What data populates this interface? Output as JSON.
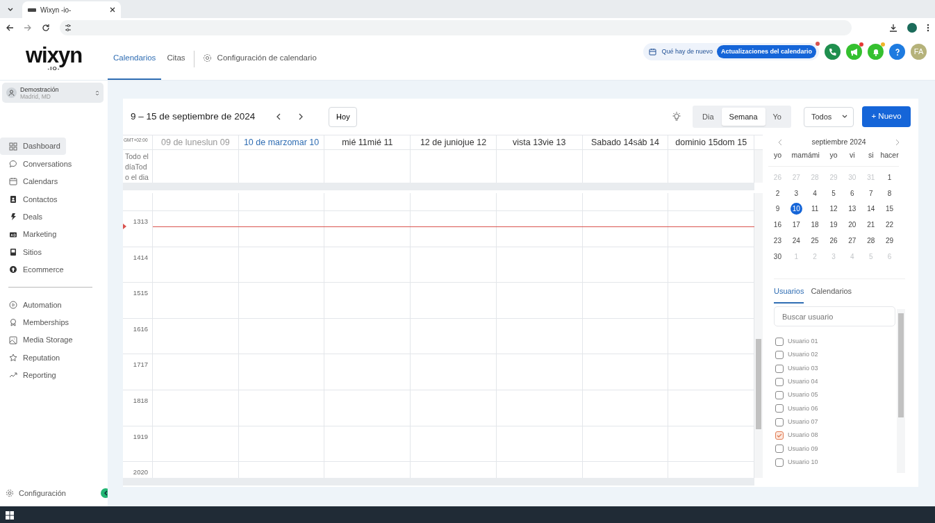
{
  "browser": {
    "tab_title": "Wixyn -io-"
  },
  "logo": {
    "name": "wixyn",
    "tagline": "-IO-"
  },
  "header_tabs": [
    {
      "label": "Calendarios",
      "selected": true,
      "kind": "text"
    },
    {
      "label": "Citas",
      "selected": false,
      "kind": "text"
    },
    {
      "label": "Configuración de calendario",
      "selected": false,
      "kind": "settings"
    }
  ],
  "whats_new": {
    "label": "Qué hay de nuevo",
    "badge": "Actualizaciones del calendario",
    "unread": true
  },
  "header_buttons": [
    {
      "kind": "phone",
      "unread": false
    },
    {
      "kind": "megaphone",
      "unread": true
    },
    {
      "kind": "bell",
      "unread": true
    },
    {
      "kind": "help",
      "unread": false
    },
    {
      "kind": "avatar",
      "label": "FA",
      "unread": false
    }
  ],
  "account": {
    "name": "Demostración",
    "location": "Madrid, MD"
  },
  "sidebar": {
    "groups": [
      {
        "items": [
          {
            "label": "Dashboard",
            "selected": true
          },
          {
            "label": "Conversations",
            "selected": false
          },
          {
            "label": "Calendars",
            "selected": false
          },
          {
            "label": "Contactos",
            "selected": false
          },
          {
            "label": "Deals",
            "selected": false
          },
          {
            "label": "Marketing",
            "selected": false
          },
          {
            "label": "Sitios",
            "selected": false
          },
          {
            "label": "Ecommerce",
            "selected": false
          }
        ]
      },
      {
        "items": [
          {
            "label": "Automation",
            "selected": false
          },
          {
            "label": "Memberships",
            "selected": false
          },
          {
            "label": "Media Storage",
            "selected": false
          },
          {
            "label": "Reputation",
            "selected": false
          },
          {
            "label": "Reporting",
            "selected": false
          }
        ]
      }
    ],
    "footer": "Configuración"
  },
  "toolbar": {
    "range": "9 – 15 de septiembre de 2024",
    "today": "Hoy",
    "views": [
      {
        "label": "Dia",
        "selected": false
      },
      {
        "label": "Semana",
        "selected": true
      },
      {
        "label": "Yo",
        "selected": false
      }
    ],
    "filter": "Todos",
    "new": "+ Nuevo"
  },
  "grid": {
    "timezone": "GMT+02:00",
    "all_day": "Todo el díaTodo el dia",
    "days": [
      {
        "label": "09 de luneslun 09",
        "kind": "past"
      },
      {
        "label": "10 de marzomar 10",
        "kind": "today"
      },
      {
        "label": "mié 11mié 11",
        "kind": "future"
      },
      {
        "label": "12 de juniojue 12",
        "kind": "future"
      },
      {
        "label": "vista 13vie 13",
        "kind": "future"
      },
      {
        "label": "Sabado 14sáb 14",
        "kind": "future"
      },
      {
        "label": "dominio 15dom 15",
        "kind": "future"
      }
    ],
    "hours": [
      "1313",
      "1414",
      "1515",
      "1616",
      "1717",
      "1818",
      "1919",
      "2020"
    ]
  },
  "mini_calendar": {
    "month": "septiembre 2024",
    "weekdays": [
      "yo",
      "mamámi",
      "yo",
      "vi",
      "si",
      "hacer"
    ],
    "weeks": [
      [
        {
          "label": "26",
          "muted": true,
          "selected": false
        },
        {
          "label": "27",
          "muted": true,
          "selected": false
        },
        {
          "label": "28",
          "muted": true,
          "selected": false
        },
        {
          "label": "29",
          "muted": true,
          "selected": false
        },
        {
          "label": "30",
          "muted": true,
          "selected": false
        },
        {
          "label": "31",
          "muted": true,
          "selected": false
        },
        {
          "label": "1",
          "muted": false,
          "selected": false
        }
      ],
      [
        {
          "label": "2",
          "muted": false,
          "selected": false
        },
        {
          "label": "3",
          "muted": false,
          "selected": false
        },
        {
          "label": "4",
          "muted": false,
          "selected": false
        },
        {
          "label": "5",
          "muted": false,
          "selected": false
        },
        {
          "label": "6",
          "muted": false,
          "selected": false
        },
        {
          "label": "7",
          "muted": false,
          "selected": false
        },
        {
          "label": "8",
          "muted": false,
          "selected": false
        }
      ],
      [
        {
          "label": "9",
          "muted": false,
          "selected": false
        },
        {
          "label": "10",
          "muted": false,
          "selected": true
        },
        {
          "label": "11",
          "muted": false,
          "selected": false
        },
        {
          "label": "12",
          "muted": false,
          "selected": false
        },
        {
          "label": "13",
          "muted": false,
          "selected": false
        },
        {
          "label": "14",
          "muted": false,
          "selected": false
        },
        {
          "label": "15",
          "muted": false,
          "selected": false
        }
      ],
      [
        {
          "label": "16",
          "muted": false,
          "selected": false
        },
        {
          "label": "17",
          "muted": false,
          "selected": false
        },
        {
          "label": "18",
          "muted": false,
          "selected": false
        },
        {
          "label": "19",
          "muted": false,
          "selected": false
        },
        {
          "label": "20",
          "muted": false,
          "selected": false
        },
        {
          "label": "21",
          "muted": false,
          "selected": false
        },
        {
          "label": "22",
          "muted": false,
          "selected": false
        }
      ],
      [
        {
          "label": "23",
          "muted": false,
          "selected": false
        },
        {
          "label": "24",
          "muted": false,
          "selected": false
        },
        {
          "label": "25",
          "muted": false,
          "selected": false
        },
        {
          "label": "26",
          "muted": false,
          "selected": false
        },
        {
          "label": "27",
          "muted": false,
          "selected": false
        },
        {
          "label": "28",
          "muted": false,
          "selected": false
        },
        {
          "label": "29",
          "muted": false,
          "selected": false
        }
      ],
      [
        {
          "label": "30",
          "muted": false,
          "selected": false
        },
        {
          "label": "1",
          "muted": true,
          "selected": false
        },
        {
          "label": "2",
          "muted": true,
          "selected": false
        },
        {
          "label": "3",
          "muted": true,
          "selected": false
        },
        {
          "label": "4",
          "muted": true,
          "selected": false
        },
        {
          "label": "5",
          "muted": true,
          "selected": false
        },
        {
          "label": "6",
          "muted": true,
          "selected": false
        }
      ]
    ]
  },
  "filter_panel": {
    "tabs": [
      {
        "label": "Usuarios",
        "selected": true
      },
      {
        "label": "Calendarios",
        "selected": false
      }
    ],
    "search": {
      "placeholder": "Buscar usuario"
    },
    "users": [
      {
        "label": "Usuario 01",
        "checked": false
      },
      {
        "label": "Usuario 02",
        "checked": false
      },
      {
        "label": "Usuario 03",
        "checked": false
      },
      {
        "label": "Usuario 04",
        "checked": false
      },
      {
        "label": "Usuario 05",
        "checked": false
      },
      {
        "label": "Usuario 06",
        "checked": false
      },
      {
        "label": "Usuario 07",
        "checked": false
      },
      {
        "label": "Usuario 08",
        "checked": true
      },
      {
        "label": "Usuario 09",
        "checked": false
      },
      {
        "label": "Usuario 10",
        "checked": false
      }
    ]
  }
}
